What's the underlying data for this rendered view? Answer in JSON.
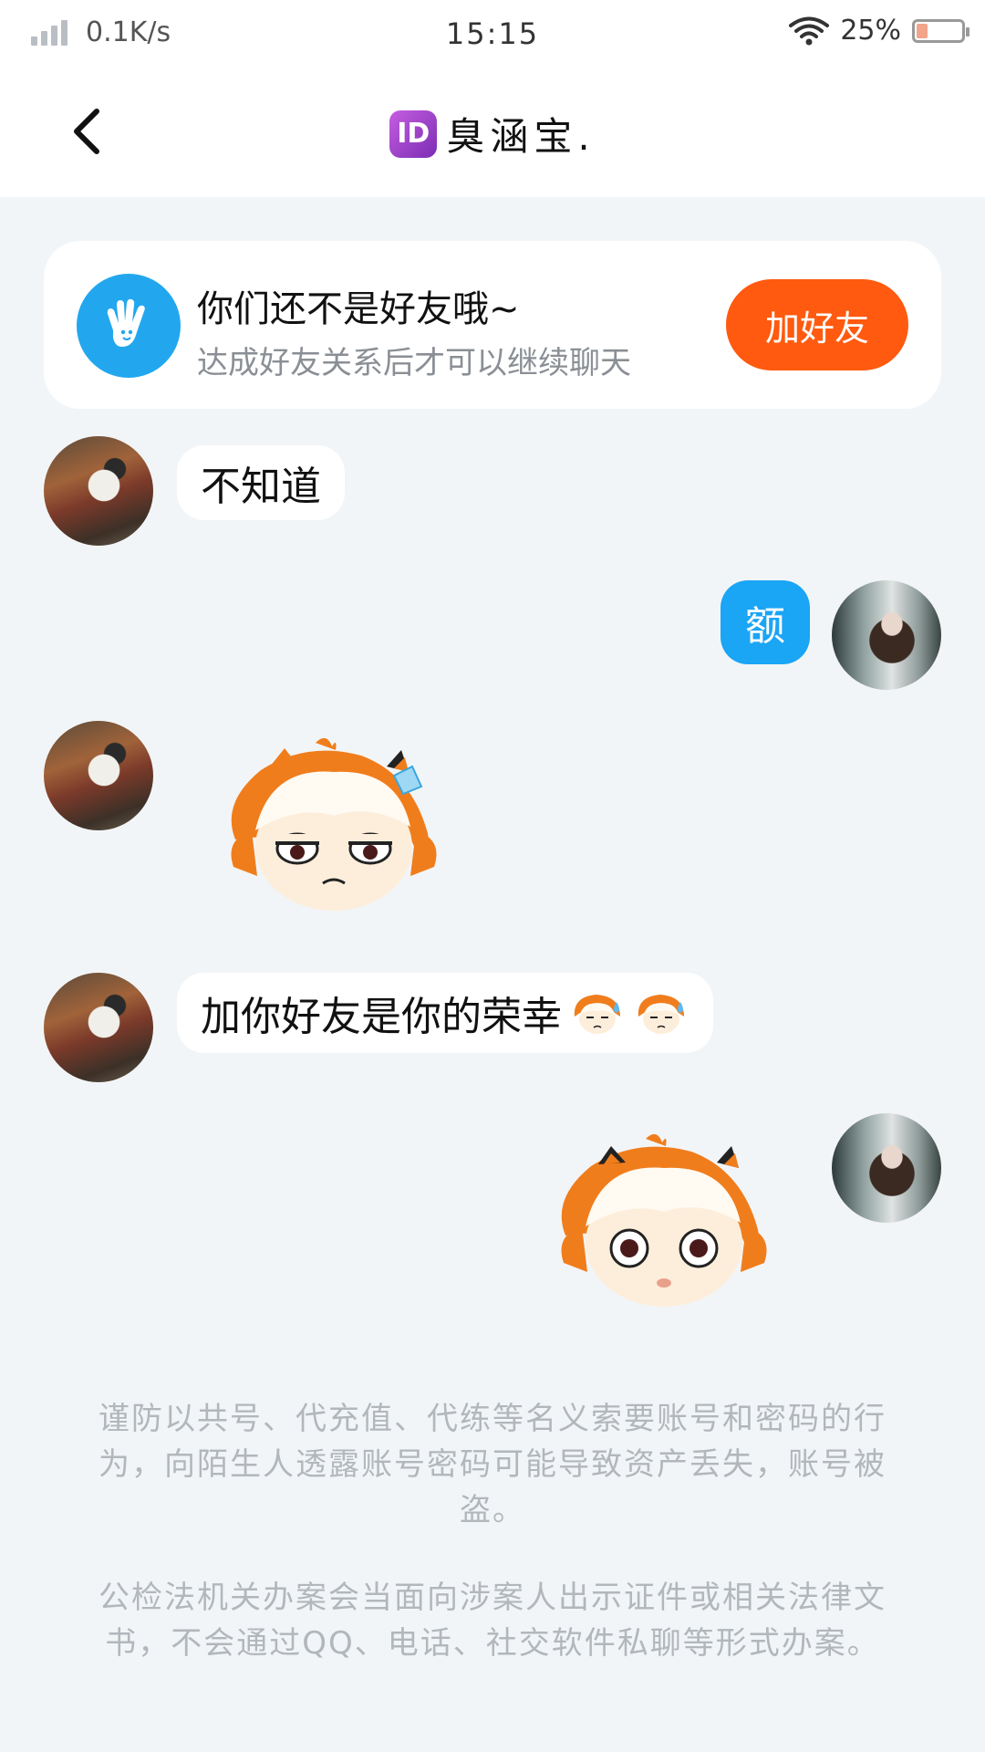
{
  "status_bar": {
    "network_speed": "0.1K/s",
    "time": "15:15",
    "battery": "25%",
    "battery_level": 0.25
  },
  "header": {
    "title": "臭涵宝.",
    "badge_text": "ID"
  },
  "friend_card": {
    "title": "你们还不是好友哦~",
    "subtitle": "达成好友关系后才可以继续聊天",
    "button_label": "加好友"
  },
  "messages": [
    {
      "from": "them",
      "type": "text",
      "text": "不知道"
    },
    {
      "from": "me",
      "type": "text",
      "text": "额"
    },
    {
      "from": "them",
      "type": "sticker",
      "sticker": "annoyed-girl-sticker"
    },
    {
      "from": "them",
      "type": "text",
      "text": "加你好友是你的荣幸"
    },
    {
      "from": "me",
      "type": "sticker",
      "sticker": "surprised-girl-sticker"
    }
  ],
  "notices": [
    "谨防以共号、代充值、代练等名义索要账号和密码的行为，向陌生人透露账号密码可能导致资产丢失，账号被盗。",
    "公检法机关办案会当面向涉案人出示证件或相关法律文书，不会通过QQ、电话、社交软件私聊等形式办案。"
  ],
  "colors": {
    "accent_orange": "#ff5a0f",
    "bubble_blue": "#1aa5f5",
    "hand_icon_blue": "#22a7ef",
    "background": "#f2f5f7"
  }
}
